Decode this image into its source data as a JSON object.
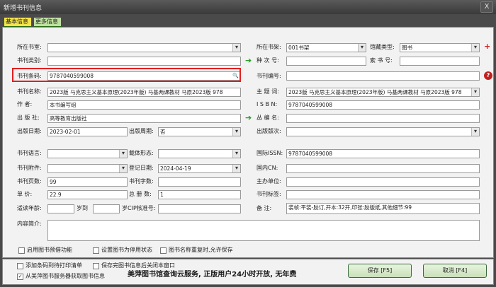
{
  "window": {
    "title": "新增书刊信息",
    "close": "X"
  },
  "tabs": [
    "基本信息",
    "更多信息"
  ],
  "labels": {
    "location": "所在书室:",
    "shelf": "所在书架:",
    "collection_type": "馆藏类型:",
    "category": "书刊类别:",
    "seq_no": "种 次 号:",
    "call_no": "索 书 号:",
    "barcode": "书刊条码:",
    "book_no": "书刊编号:",
    "name": "书刊名称:",
    "subject": "主 题 词:",
    "author": "作    者:",
    "isbn": "I S B N:",
    "publisher": "出 版 社:",
    "series": "丛 编 名:",
    "pub_date": "出版日期:",
    "period": "出版周期:",
    "edition": "出版版次:",
    "language": "书刊语言:",
    "carrier": "载体形态:",
    "issn": "国际ISSN:",
    "attachment": "书刊附件:",
    "reg_date": "登记日期:",
    "cn": "国内CN:",
    "pages": "书刊页数:",
    "words": "书刊字数:",
    "responsible": "主办单位:",
    "price": "单     价:",
    "volumes": "总 册 数:",
    "tags": "书刊标签:",
    "age": "适读年龄:",
    "age_to": "岁到",
    "cip": "岁CIP核准号:",
    "note": "备     注:",
    "summary": "内容简介:"
  },
  "values": {
    "shelf": "001书架",
    "collection_type": "图书",
    "barcode": "9787040599008",
    "name": "2023版 马克思主义基本原理(2023年版) 马基两课教材 马原2023版 978",
    "subject": "2023版 马克思主义基本原理(2023年版) 马基两课教材 马原2023版 978",
    "author": "本书编写组",
    "isbn": "9787040599008",
    "publisher": "高等教育出版社",
    "pub_date": "2023-02-01",
    "period": "否",
    "issn": "9787040599008",
    "reg_date": "2024-04-19",
    "pages": "99",
    "price": "22.9",
    "volumes": "1",
    "note": "装帧:平装-胶订,开本:32开,印张:胶版纸,其他细节:99"
  },
  "checkboxes": {
    "prebook": "启用图书预借功能",
    "disable": "设置图书为停用状态",
    "dup": "图书名称重复时,允许保存",
    "print": "添加条码到待打印清单",
    "close_after": "保存完图书信息后关闭本窗口",
    "fetch": "从美萍图书服务器获取图书信息"
  },
  "checked": {
    "prebook": false,
    "disable": false,
    "dup": false,
    "print": false,
    "close_after": false,
    "fetch": true
  },
  "banner": "美萍图书馆查询云服务, 正版用户24小时开放, 无年费",
  "buttons": {
    "save": "保存 [F5]",
    "cancel": "取消 [F4]"
  },
  "icons": {
    "add": "+",
    "help": "?",
    "search": "🔍",
    "arrow": "➔"
  }
}
